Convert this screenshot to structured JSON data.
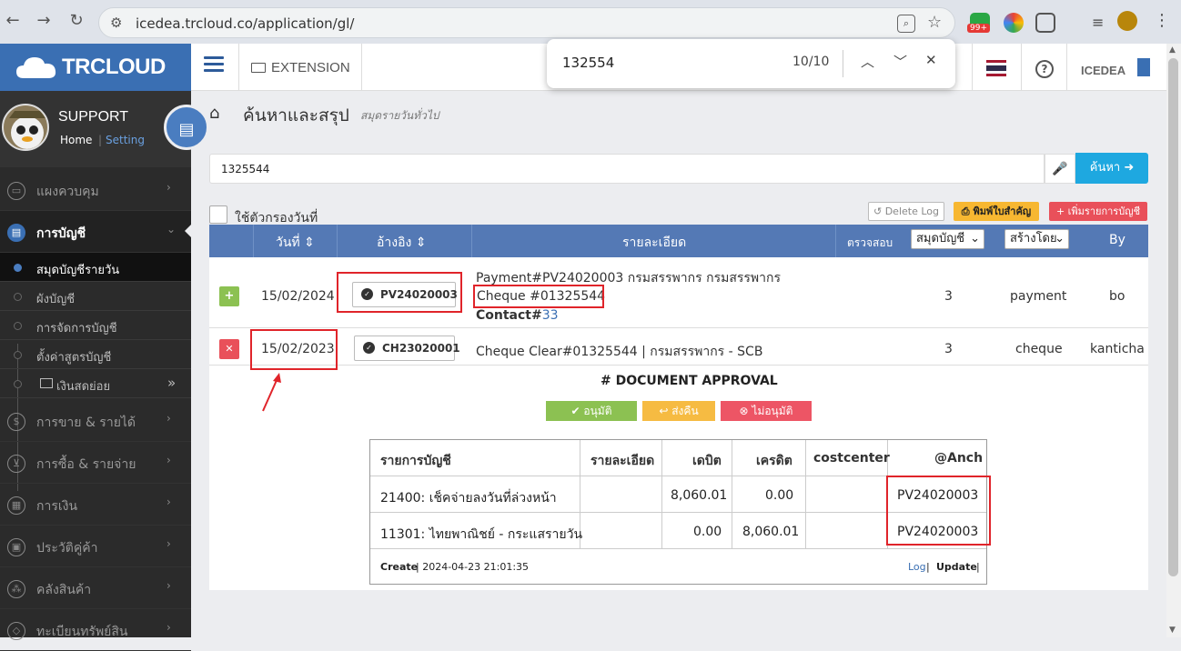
{
  "browser": {
    "url": "icedea.trcloud.co/application/gl/",
    "ext_badge": "99+"
  },
  "findbar": {
    "query": "132554",
    "count": "10/10"
  },
  "app": {
    "brand": "TRCLOUD",
    "extension_label": "EXTENSION",
    "company": "ICEDEA",
    "help": "?"
  },
  "sidebar": {
    "user_name": "SUPPORT",
    "home": "Home",
    "setting": "Setting",
    "items": [
      {
        "label": "แผงควบคุม",
        "icon": "monitor-icon"
      },
      {
        "label": "การบัญชี",
        "icon": "book-icon"
      },
      {
        "label": "การขาย & รายได้",
        "icon": "dollar-icon"
      },
      {
        "label": "การซื้อ & รายจ่าย",
        "icon": "cart-icon"
      },
      {
        "label": "การเงิน",
        "icon": "calendar-icon"
      },
      {
        "label": "ประวัติคู่ค้า",
        "icon": "contact-icon"
      },
      {
        "label": "คลังสินค้า",
        "icon": "cubes-icon"
      },
      {
        "label": "ทะเบียนทรัพย์สิน",
        "icon": "diamond-icon"
      }
    ],
    "subitems": [
      "สมุดบัญชีรายวัน",
      "ผังบัญชี",
      "การจัดการบัญชี",
      "ตั้งค่าสูตรบัญชี",
      "เงินสดย่อย"
    ]
  },
  "page": {
    "title": "ค้นหาและสรุป",
    "subtitle": "สมุดรายวันทั่วไป",
    "search_value": "1325544",
    "search_button": "ค้นหา",
    "date_filter_label": "ใช้ตัวกรองวันที่",
    "delete_log": "Delete Log",
    "print_important": "พิมพ์ใบสำคัญ",
    "add_entry": "เพิ่มรายการบัญชี"
  },
  "table": {
    "headers": {
      "date": "วันที่",
      "ref": "อ้างอิง",
      "detail": "รายละเอียด",
      "check": "ตรวจสอบ",
      "journal": "สมุดบัญชี",
      "created_by": "สร้างโดย",
      "by": "By"
    },
    "rows": [
      {
        "toggle": "+",
        "date": "15/02/2024",
        "ref": "PV24020003",
        "detail_line1": "Payment#PV24020003 กรมสรรพากร กรมสรรพากร",
        "detail_line2": "Cheque #01325544",
        "detail_contact_label": "Contact#",
        "detail_contact_num": "33",
        "check": "3",
        "journal": "payment",
        "by": "bo"
      },
      {
        "toggle": "✕",
        "date": "15/02/2023",
        "ref": "CH23020001",
        "detail_line1": "Cheque Clear#01325544 | กรมสรรพากร - SCB",
        "check": "3",
        "journal": "cheque",
        "by": "kanticha"
      }
    ]
  },
  "approval": {
    "title": "# DOCUMENT APPROVAL",
    "approve": "อนุมัติ",
    "return": "ส่งคืน",
    "reject": "ไม่อนุมัติ",
    "colors": {
      "approve": "#8cc152",
      "return": "#f6bb42",
      "reject": "#ed5565"
    }
  },
  "accounts": {
    "headers": [
      "รายการบัญชี",
      "รายละเอียด",
      "เดบิต",
      "เครดิต",
      "costcenter",
      "@Anch"
    ],
    "rows": [
      {
        "account": "21400: เช็คจ่ายลงวันที่ล่วงหน้า",
        "detail": "",
        "debit": "8,060.01",
        "credit": "0.00",
        "costcenter": "",
        "anch": "PV24020003"
      },
      {
        "account": "11301: ไทยพาณิชย์ - กระแสรายวัน",
        "detail": "",
        "debit": "0.00",
        "credit": "8,060.01",
        "costcenter": "",
        "anch": "PV24020003"
      }
    ],
    "footer_create_label": "Create",
    "footer_create_time": "| 2024-04-23 21:01:35",
    "footer_log": "Log",
    "footer_update": "Update"
  }
}
